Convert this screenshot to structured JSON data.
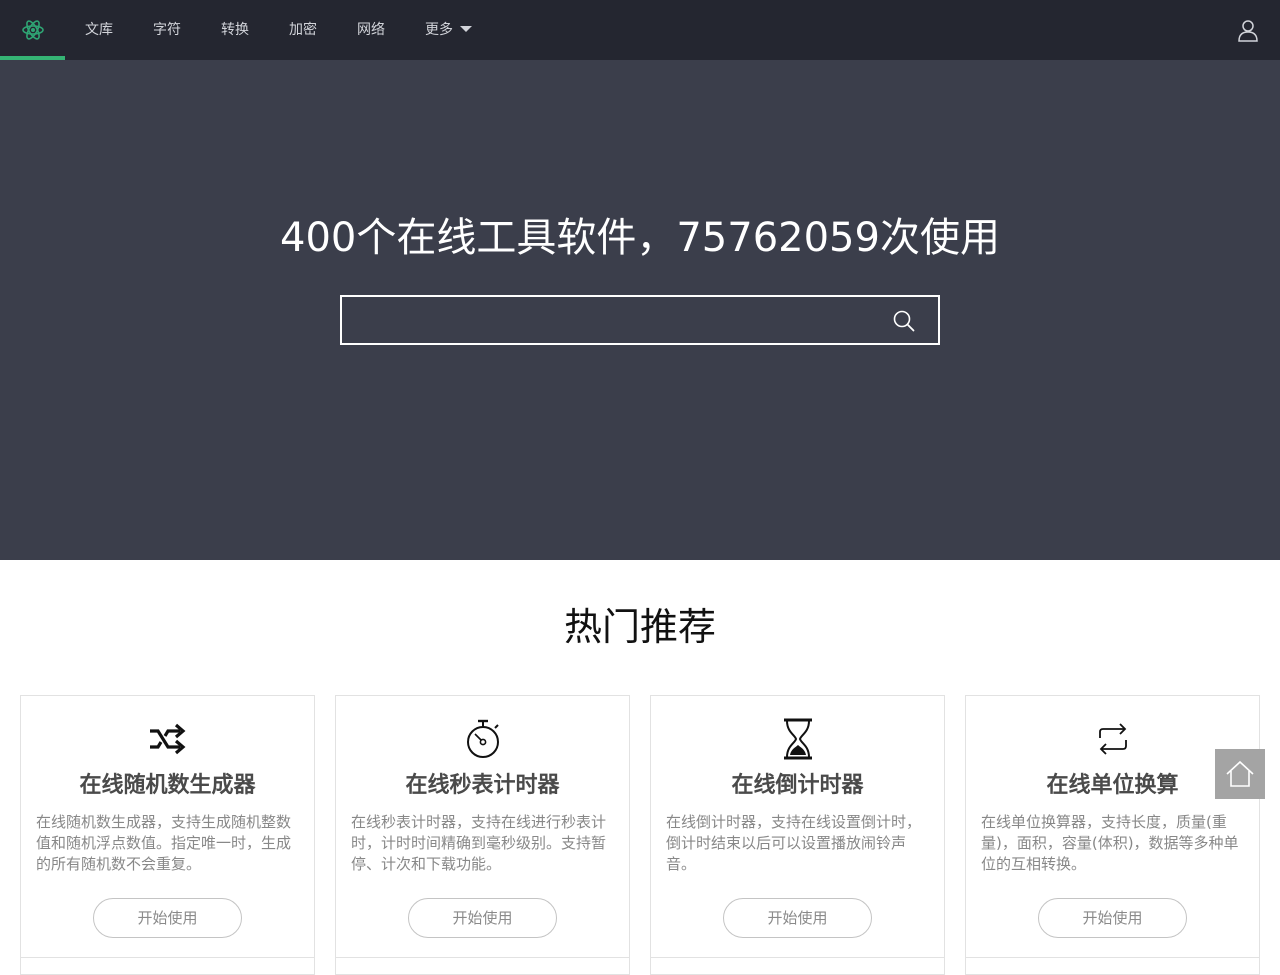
{
  "nav": {
    "logo_icon": "atom-logo-icon",
    "accent": "#35b474",
    "items": [
      {
        "label": "文库"
      },
      {
        "label": "字符"
      },
      {
        "label": "转换"
      },
      {
        "label": "加密"
      },
      {
        "label": "网络"
      },
      {
        "label": "更多"
      }
    ],
    "user_icon": "user-icon"
  },
  "hero": {
    "title": "400个在线工具软件，75762059次使用",
    "search": {
      "value": "",
      "placeholder": "",
      "icon": "search-icon"
    }
  },
  "section": {
    "title": "热门推荐",
    "cards": [
      {
        "icon": "shuffle-icon",
        "title": "在线随机数生成器",
        "desc": "在线随机数生成器，支持生成随机整数值和随机浮点数值。指定唯一时，生成的所有随机数不会重复。",
        "button": "开始使用"
      },
      {
        "icon": "stopwatch-icon",
        "title": "在线秒表计时器",
        "desc": "在线秒表计时器，支持在线进行秒表计时，计时时间精确到毫秒级别。支持暂停、计次和下载功能。",
        "button": "开始使用"
      },
      {
        "icon": "hourglass-icon",
        "title": "在线倒计时器",
        "desc": "在线倒计时器，支持在线设置倒计时，倒计时结束以后可以设置播放闹铃声音。",
        "button": "开始使用"
      },
      {
        "icon": "repeat-arrows-icon",
        "title": "在线单位换算",
        "desc": "在线单位换算器，支持长度，质量(重量)，面积，容量(体积)，数据等多种单位的互相转换。",
        "button": "开始使用"
      }
    ]
  },
  "home_button": {
    "icon": "home-icon"
  }
}
